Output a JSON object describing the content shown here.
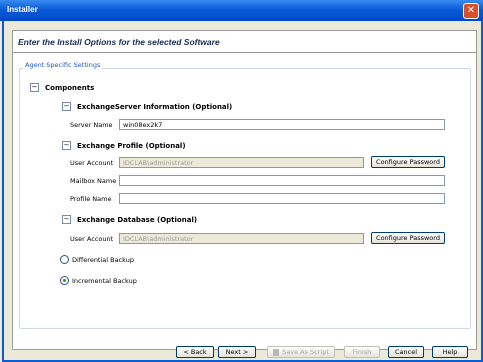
{
  "window": {
    "title": "Installer",
    "close_glyph": "✕"
  },
  "page": {
    "heading": "Enter the Install Options for the selected Software"
  },
  "group": {
    "label": "Agent Specific Settings"
  },
  "components": {
    "title": "Components",
    "exchange_server": {
      "title": "ExchangeServer Information (Optional)",
      "server_name_label": "Server Name",
      "server_name_value": "win08ex2k7"
    },
    "exchange_profile": {
      "title": "Exchange Profile (Optional)",
      "user_account_label": "User Account",
      "user_account_value": "IDCLAB\\administrator",
      "configure_password": "Configure Password",
      "mailbox_name_label": "Mailbox Name",
      "mailbox_name_value": "",
      "profile_name_label": "Profile Name",
      "profile_name_value": ""
    },
    "exchange_database": {
      "title": "Exchange Database (Optional)",
      "user_account_label": "User Account",
      "user_account_value": "IDCLAB\\administrator",
      "configure_password": "Configure Password",
      "differential": "Differential Backup",
      "incremental": "Incremental Backup",
      "selected": "Incremental Backup"
    }
  },
  "footer": {
    "back": "< Back",
    "next": "Next >",
    "save_as_script": "Save As Script",
    "finish": "Finish",
    "cancel": "Cancel",
    "help": "Help"
  }
}
